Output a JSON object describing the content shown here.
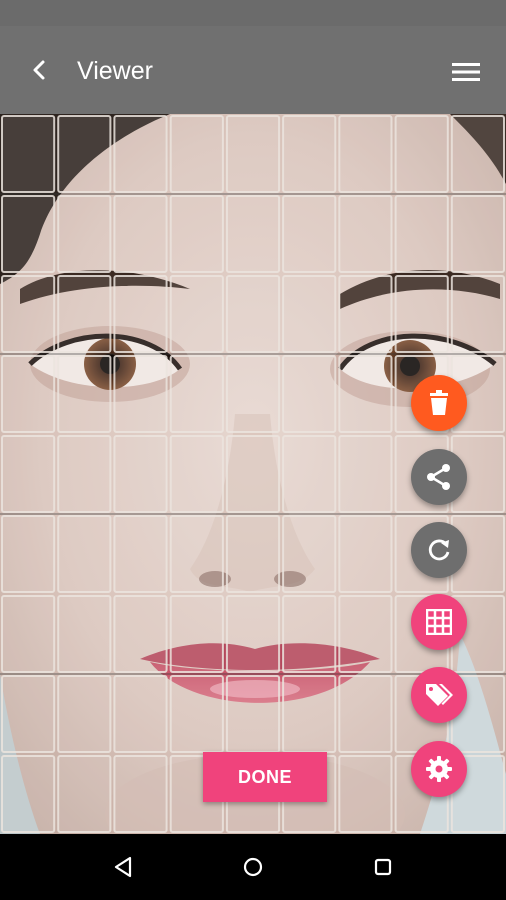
{
  "app_bar": {
    "title": "Viewer",
    "back_icon": "chevron-left-icon",
    "menu_icon": "hamburger-menu-icon"
  },
  "viewer": {
    "overlay": "grid",
    "columns": 9,
    "rows": 9
  },
  "fabs": [
    {
      "name": "delete-button",
      "icon": "trash-icon",
      "color": "#ff5a1f"
    },
    {
      "name": "share-button",
      "icon": "share-icon",
      "color": "#6e6e6e"
    },
    {
      "name": "rotate-button",
      "icon": "refresh-icon",
      "color": "#6e6e6e"
    },
    {
      "name": "grid-button",
      "icon": "grid-icon",
      "color": "#f0437c"
    },
    {
      "name": "tag-button",
      "icon": "tag-icon",
      "color": "#f0437c"
    },
    {
      "name": "settings-button",
      "icon": "gear-icon",
      "color": "#f0437c"
    }
  ],
  "done_button": {
    "label": "DONE",
    "color": "#f0437c"
  },
  "navbar": {
    "back_icon": "triangle-back-icon",
    "home_icon": "circle-home-icon",
    "recents_icon": "square-recents-icon"
  }
}
